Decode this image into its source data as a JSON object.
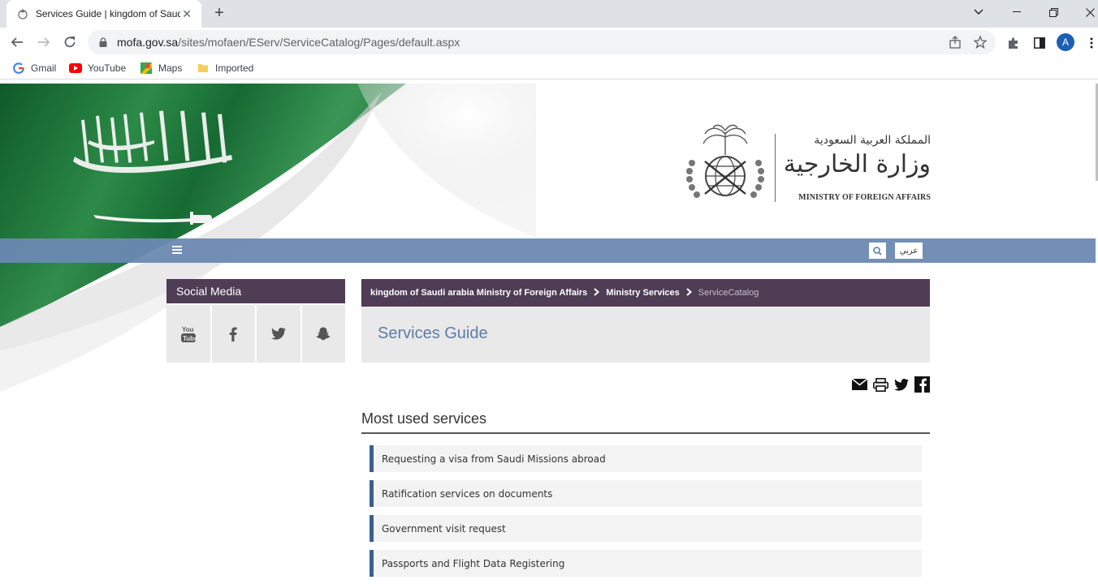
{
  "browser": {
    "tab_title": "Services Guide | kingdom of Saudi Arabia Ministry of Foreign Affairs",
    "url_host": "mofa.gov.sa",
    "url_path": "/sites/mofaen/EServ/ServiceCatalog/Pages/default.aspx",
    "profile_initial": "A",
    "bookmarks": [
      {
        "label": "Gmail",
        "icon": "google-icon"
      },
      {
        "label": "YouTube",
        "icon": "youtube-icon"
      },
      {
        "label": "Maps",
        "icon": "maps-icon"
      },
      {
        "label": "Imported",
        "icon": "folder-icon"
      }
    ]
  },
  "header": {
    "logo_ar_small": "المملكة العربية السعودية",
    "logo_ar_big": "وزارة الخارجية",
    "logo_en": "MINISTRY OF FOREIGN AFFAIRS",
    "lang_label": "عربي"
  },
  "sidebar": {
    "social_title": "Social Media",
    "social_icons": [
      "youtube-icon",
      "facebook-icon",
      "twitter-icon",
      "snapchat-icon"
    ]
  },
  "main": {
    "breadcrumb": [
      "kingdom of Saudi arabia Ministry of Foreign Affairs",
      "Ministry Services",
      "ServiceCatalog"
    ],
    "page_title": "Services Guide",
    "share_icons": [
      "email-icon",
      "print-icon",
      "twitter-icon",
      "facebook-icon"
    ],
    "section_title": "Most used services",
    "services": [
      "Requesting a visa from Saudi Missions abroad",
      "Ratification services on documents",
      "Government visit request",
      "Passports and Flight Data Registering"
    ]
  },
  "colors": {
    "nav_bar": "#6c89b2",
    "panel_header": "#4f3c55",
    "title_text": "#5d7ca5",
    "service_accent": "#3c5f8f",
    "flag_green": "#1f7a3a"
  }
}
